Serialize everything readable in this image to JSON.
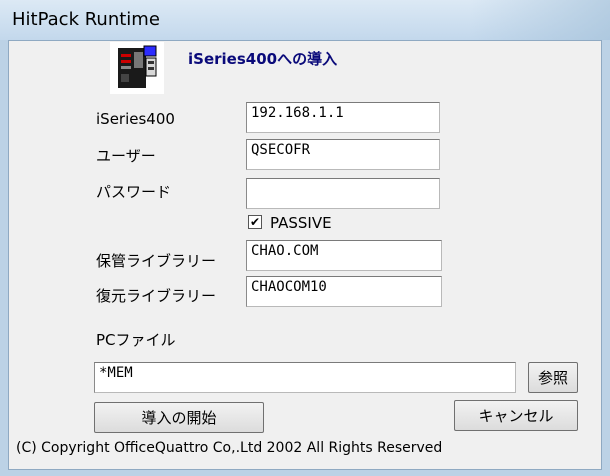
{
  "window": {
    "title": "HitPack Runtime"
  },
  "header": {
    "logo_icon": "server-machine-icon",
    "title": "iSeries400への導入"
  },
  "form": {
    "host_label": "iSeries400",
    "host_value": "192.168.1.1",
    "user_label": "ユーザー",
    "user_value": "QSECOFR",
    "password_label": "パスワード",
    "password_value": "",
    "passive_label": "PASSIVE",
    "passive_checked": "✔",
    "save_lib_label": "保管ライブラリー",
    "save_lib_value": "CHAO.COM",
    "restore_lib_label": "復元ライブラリー",
    "restore_lib_value": "CHAOCOM10",
    "pcfile_label": "PCファイル",
    "pcfile_value": "*MEM"
  },
  "buttons": {
    "browse_label": "参照",
    "start_label": "導入の開始",
    "cancel_label": "キャンセル"
  },
  "footer": {
    "copyright": "(C) Copyright OfficeQuattro Co,.Ltd 2002 All Rights Reserved"
  }
}
